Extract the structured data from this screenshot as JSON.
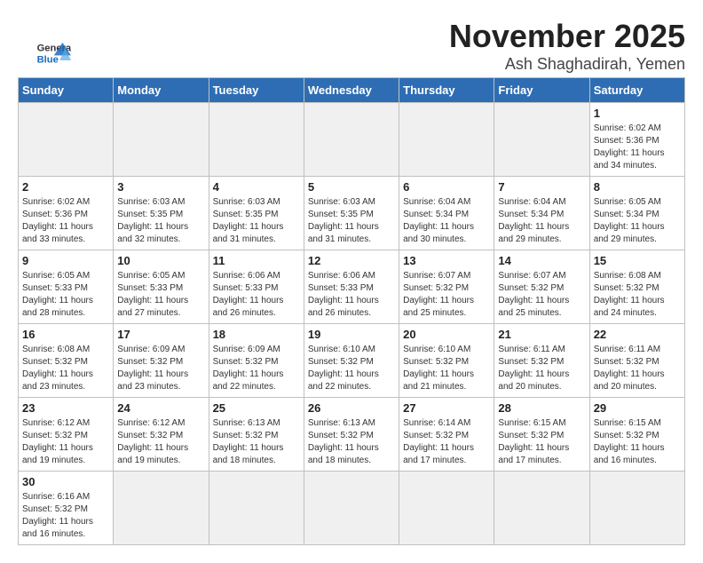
{
  "logo": {
    "general": "General",
    "blue": "Blue"
  },
  "header": {
    "title": "November 2025",
    "subtitle": "Ash Shaghadirah, Yemen"
  },
  "days_of_week": [
    "Sunday",
    "Monday",
    "Tuesday",
    "Wednesday",
    "Thursday",
    "Friday",
    "Saturday"
  ],
  "weeks": [
    [
      {
        "day": "",
        "info": "",
        "empty": true
      },
      {
        "day": "",
        "info": "",
        "empty": true
      },
      {
        "day": "",
        "info": "",
        "empty": true
      },
      {
        "day": "",
        "info": "",
        "empty": true
      },
      {
        "day": "",
        "info": "",
        "empty": true
      },
      {
        "day": "",
        "info": "",
        "empty": true
      },
      {
        "day": "1",
        "info": "Sunrise: 6:02 AM\nSunset: 5:36 PM\nDaylight: 11 hours and 34 minutes.",
        "empty": false
      }
    ],
    [
      {
        "day": "2",
        "info": "Sunrise: 6:02 AM\nSunset: 5:36 PM\nDaylight: 11 hours and 33 minutes.",
        "empty": false
      },
      {
        "day": "3",
        "info": "Sunrise: 6:03 AM\nSunset: 5:35 PM\nDaylight: 11 hours and 32 minutes.",
        "empty": false
      },
      {
        "day": "4",
        "info": "Sunrise: 6:03 AM\nSunset: 5:35 PM\nDaylight: 11 hours and 31 minutes.",
        "empty": false
      },
      {
        "day": "5",
        "info": "Sunrise: 6:03 AM\nSunset: 5:35 PM\nDaylight: 11 hours and 31 minutes.",
        "empty": false
      },
      {
        "day": "6",
        "info": "Sunrise: 6:04 AM\nSunset: 5:34 PM\nDaylight: 11 hours and 30 minutes.",
        "empty": false
      },
      {
        "day": "7",
        "info": "Sunrise: 6:04 AM\nSunset: 5:34 PM\nDaylight: 11 hours and 29 minutes.",
        "empty": false
      },
      {
        "day": "8",
        "info": "Sunrise: 6:05 AM\nSunset: 5:34 PM\nDaylight: 11 hours and 29 minutes.",
        "empty": false
      }
    ],
    [
      {
        "day": "9",
        "info": "Sunrise: 6:05 AM\nSunset: 5:33 PM\nDaylight: 11 hours and 28 minutes.",
        "empty": false
      },
      {
        "day": "10",
        "info": "Sunrise: 6:05 AM\nSunset: 5:33 PM\nDaylight: 11 hours and 27 minutes.",
        "empty": false
      },
      {
        "day": "11",
        "info": "Sunrise: 6:06 AM\nSunset: 5:33 PM\nDaylight: 11 hours and 26 minutes.",
        "empty": false
      },
      {
        "day": "12",
        "info": "Sunrise: 6:06 AM\nSunset: 5:33 PM\nDaylight: 11 hours and 26 minutes.",
        "empty": false
      },
      {
        "day": "13",
        "info": "Sunrise: 6:07 AM\nSunset: 5:32 PM\nDaylight: 11 hours and 25 minutes.",
        "empty": false
      },
      {
        "day": "14",
        "info": "Sunrise: 6:07 AM\nSunset: 5:32 PM\nDaylight: 11 hours and 25 minutes.",
        "empty": false
      },
      {
        "day": "15",
        "info": "Sunrise: 6:08 AM\nSunset: 5:32 PM\nDaylight: 11 hours and 24 minutes.",
        "empty": false
      }
    ],
    [
      {
        "day": "16",
        "info": "Sunrise: 6:08 AM\nSunset: 5:32 PM\nDaylight: 11 hours and 23 minutes.",
        "empty": false
      },
      {
        "day": "17",
        "info": "Sunrise: 6:09 AM\nSunset: 5:32 PM\nDaylight: 11 hours and 23 minutes.",
        "empty": false
      },
      {
        "day": "18",
        "info": "Sunrise: 6:09 AM\nSunset: 5:32 PM\nDaylight: 11 hours and 22 minutes.",
        "empty": false
      },
      {
        "day": "19",
        "info": "Sunrise: 6:10 AM\nSunset: 5:32 PM\nDaylight: 11 hours and 22 minutes.",
        "empty": false
      },
      {
        "day": "20",
        "info": "Sunrise: 6:10 AM\nSunset: 5:32 PM\nDaylight: 11 hours and 21 minutes.",
        "empty": false
      },
      {
        "day": "21",
        "info": "Sunrise: 6:11 AM\nSunset: 5:32 PM\nDaylight: 11 hours and 20 minutes.",
        "empty": false
      },
      {
        "day": "22",
        "info": "Sunrise: 6:11 AM\nSunset: 5:32 PM\nDaylight: 11 hours and 20 minutes.",
        "empty": false
      }
    ],
    [
      {
        "day": "23",
        "info": "Sunrise: 6:12 AM\nSunset: 5:32 PM\nDaylight: 11 hours and 19 minutes.",
        "empty": false
      },
      {
        "day": "24",
        "info": "Sunrise: 6:12 AM\nSunset: 5:32 PM\nDaylight: 11 hours and 19 minutes.",
        "empty": false
      },
      {
        "day": "25",
        "info": "Sunrise: 6:13 AM\nSunset: 5:32 PM\nDaylight: 11 hours and 18 minutes.",
        "empty": false
      },
      {
        "day": "26",
        "info": "Sunrise: 6:13 AM\nSunset: 5:32 PM\nDaylight: 11 hours and 18 minutes.",
        "empty": false
      },
      {
        "day": "27",
        "info": "Sunrise: 6:14 AM\nSunset: 5:32 PM\nDaylight: 11 hours and 17 minutes.",
        "empty": false
      },
      {
        "day": "28",
        "info": "Sunrise: 6:15 AM\nSunset: 5:32 PM\nDaylight: 11 hours and 17 minutes.",
        "empty": false
      },
      {
        "day": "29",
        "info": "Sunrise: 6:15 AM\nSunset: 5:32 PM\nDaylight: 11 hours and 16 minutes.",
        "empty": false
      }
    ],
    [
      {
        "day": "30",
        "info": "Sunrise: 6:16 AM\nSunset: 5:32 PM\nDaylight: 11 hours and 16 minutes.",
        "empty": false
      },
      {
        "day": "",
        "info": "",
        "empty": true
      },
      {
        "day": "",
        "info": "",
        "empty": true
      },
      {
        "day": "",
        "info": "",
        "empty": true
      },
      {
        "day": "",
        "info": "",
        "empty": true
      },
      {
        "day": "",
        "info": "",
        "empty": true
      },
      {
        "day": "",
        "info": "",
        "empty": true
      }
    ]
  ]
}
